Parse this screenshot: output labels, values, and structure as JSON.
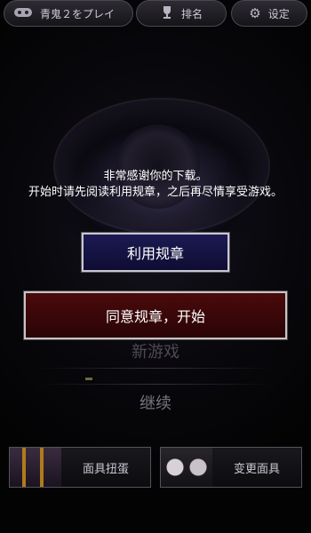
{
  "topbar": {
    "play_label": "青鬼２をプレイ",
    "rank_label": "排名",
    "settings_label": "设定"
  },
  "dialog": {
    "message_line1": "非常感谢你的下载。",
    "message_line2": "开始时请先阅读利用规章，之后再尽情享受游戏。",
    "terms_button": "利用规章",
    "agree_button": "同意规章，开始"
  },
  "menu": {
    "new_game": "新游戏",
    "continue": "继续"
  },
  "bottom": {
    "mask_gacha": "面具扭蛋",
    "change_mask": "变更面具"
  },
  "colors": {
    "terms_button_bg": "#1c1a52",
    "agree_button_bg": "#4a0a0c"
  },
  "icons": {
    "play": "controller-icon",
    "rank": "trophy-icon",
    "settings": "gear-icon"
  }
}
